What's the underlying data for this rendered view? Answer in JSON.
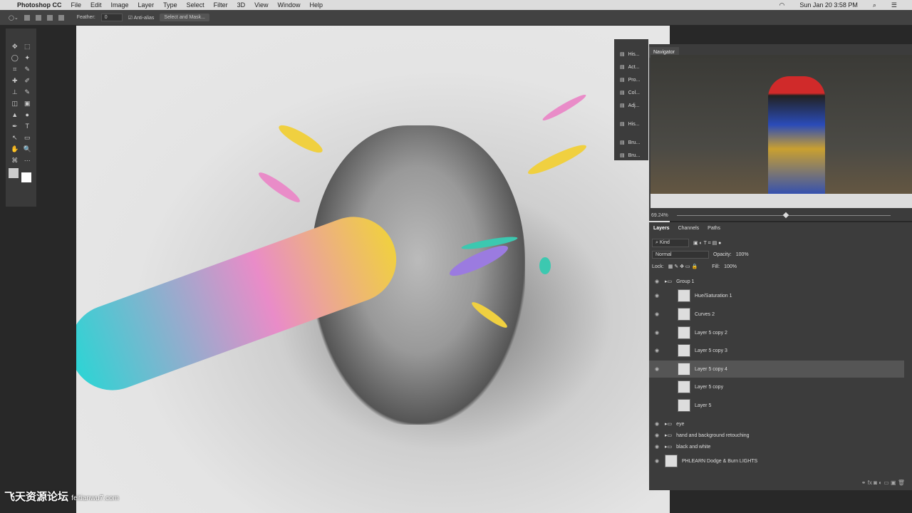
{
  "menubar": {
    "app": "Photoshop CC",
    "items": [
      "File",
      "Edit",
      "Image",
      "Layer",
      "Type",
      "Select",
      "Filter",
      "3D",
      "View",
      "Window",
      "Help"
    ],
    "clock": "Sun Jan 20  3:58 PM"
  },
  "options": {
    "feather_label": "Feather:",
    "feather_value": "0",
    "antialias": "Anti-alias",
    "select_mask": "Select and Mask..."
  },
  "tools": [
    "✥",
    "⬚",
    "◯",
    "✦",
    "⌗",
    "✎",
    "✚",
    "✐",
    "⊥",
    "✎",
    "◫",
    "▣",
    "▲",
    "●",
    "✒",
    "T",
    "↖",
    "▭",
    "✋",
    "🔍",
    "⌘",
    "⋯"
  ],
  "panel_icons": [
    "His...",
    "Act...",
    "Pro...",
    "Col...",
    "Adj...",
    "His...",
    "Bru...",
    "Bru..."
  ],
  "navigator": {
    "title": "Navigator",
    "zoom": "69.24%",
    "zoom_fraction": 0.5
  },
  "layers": {
    "tabs": [
      "Layers",
      "Channels",
      "Paths"
    ],
    "kind": "Kind",
    "blend": "Normal",
    "opacity_label": "Opacity:",
    "opacity": "100%",
    "lock_label": "Lock:",
    "fill_label": "Fill:",
    "fill": "100%",
    "rows": [
      {
        "name": "Group 1",
        "visible": true
      },
      {
        "name": "Hue/Saturation 1",
        "visible": true
      },
      {
        "name": "Curves 2",
        "visible": true
      },
      {
        "name": "Layer 5 copy 2",
        "visible": true
      },
      {
        "name": "Layer 5 copy 3",
        "visible": true
      },
      {
        "name": "Layer 5 copy 4",
        "visible": true,
        "selected": true
      },
      {
        "name": "Layer 5 copy",
        "visible": false
      },
      {
        "name": "Layer 5",
        "visible": false
      },
      {
        "name": "eye",
        "visible": true
      },
      {
        "name": "hand and background retouching",
        "visible": true
      },
      {
        "name": "black and white",
        "visible": true
      },
      {
        "name": "PHLEARN Dodge & Burn LIGHTS",
        "visible": true
      }
    ]
  },
  "watermark": {
    "text": "飞天资源论坛",
    "url": "feitianwu7.com"
  }
}
